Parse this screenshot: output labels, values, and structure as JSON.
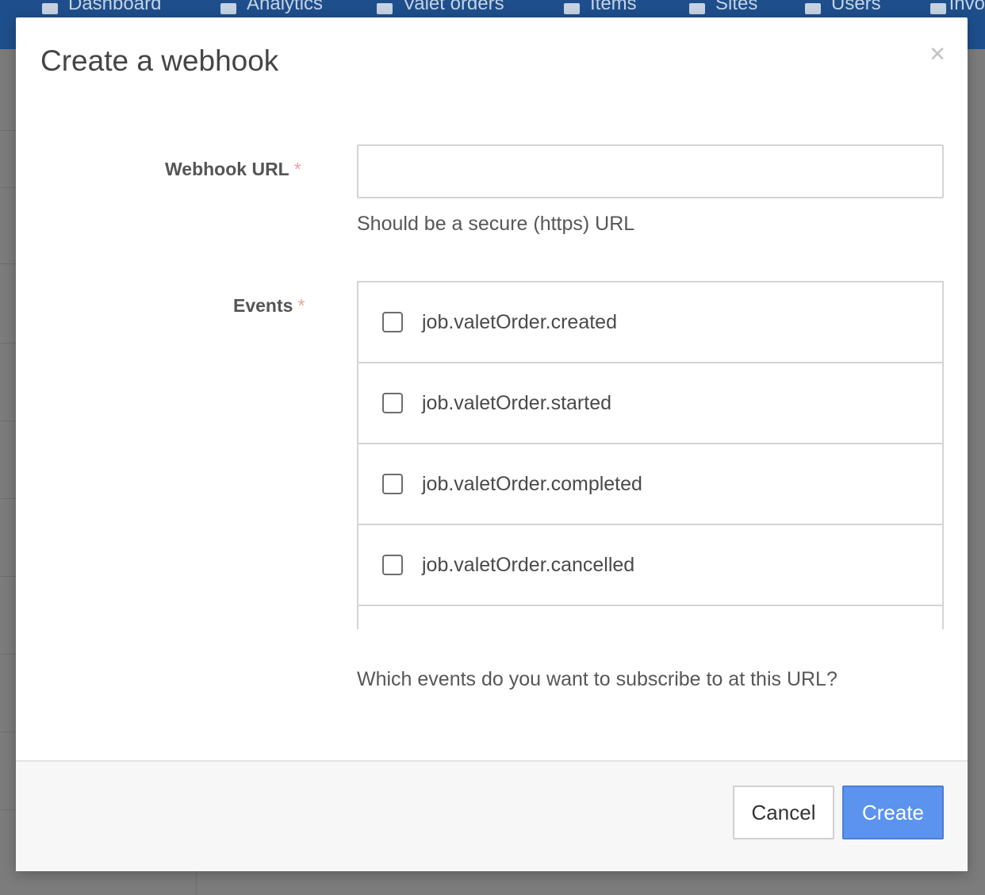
{
  "background": {
    "nav": [
      {
        "label": "Dashboard",
        "icon": "sitemap-icon"
      },
      {
        "label": "Analytics",
        "icon": "chart-line-icon"
      },
      {
        "label": "Valet orders",
        "icon": "truck-icon"
      },
      {
        "label": "Items",
        "icon": "archive-icon"
      },
      {
        "label": "Sites",
        "icon": "building-icon"
      },
      {
        "label": "Users",
        "icon": "user-icon"
      },
      {
        "label": "Invo",
        "icon": "invoice-icon"
      }
    ]
  },
  "modal": {
    "title": "Create a webhook",
    "close_symbol": "×",
    "url_field": {
      "label": "Webhook URL",
      "required_mark": "*",
      "value": "",
      "placeholder": "",
      "help": "Should be a secure (https) URL"
    },
    "events_field": {
      "label": "Events",
      "required_mark": "*",
      "options": [
        {
          "label": "job.valetOrder.created",
          "checked": false
        },
        {
          "label": "job.valetOrder.started",
          "checked": false
        },
        {
          "label": "job.valetOrder.completed",
          "checked": false
        },
        {
          "label": "job.valetOrder.cancelled",
          "checked": false
        }
      ],
      "help": "Which events do you want to subscribe to at this URL?"
    },
    "buttons": {
      "cancel": "Cancel",
      "create": "Create"
    }
  },
  "colors": {
    "primary": "#5b93ef",
    "nav_bg": "#1e4f8c",
    "required": "#f0a29a"
  }
}
